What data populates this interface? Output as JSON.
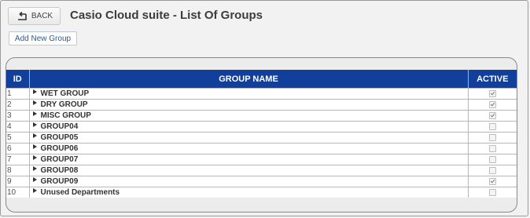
{
  "toolbar": {
    "back_label": "BACK",
    "add_label": "Add New Group"
  },
  "page": {
    "title": "Casio Cloud suite - List Of Groups"
  },
  "table": {
    "columns": [
      "ID",
      "GROUP NAME",
      "ACTIVE"
    ],
    "rows": [
      {
        "id": "1",
        "name": "WET GROUP",
        "active": true
      },
      {
        "id": "2",
        "name": "DRY GROUP",
        "active": true
      },
      {
        "id": "3",
        "name": "MISC GROUP",
        "active": true
      },
      {
        "id": "4",
        "name": "GROUP04",
        "active": false
      },
      {
        "id": "5",
        "name": "GROUP05",
        "active": false
      },
      {
        "id": "6",
        "name": "GROUP06",
        "active": false
      },
      {
        "id": "7",
        "name": "GROUP07",
        "active": false
      },
      {
        "id": "8",
        "name": "GROUP08",
        "active": false
      },
      {
        "id": "9",
        "name": "GROUP09",
        "active": true
      },
      {
        "id": "10",
        "name": "Unused Departments",
        "active": false
      }
    ]
  }
}
